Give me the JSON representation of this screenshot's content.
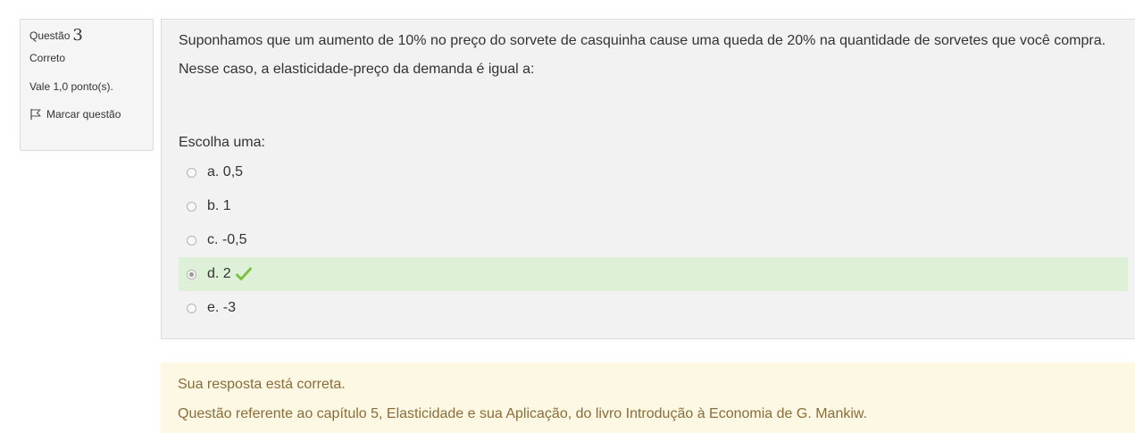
{
  "question_info": {
    "label": "Questão",
    "number": "3",
    "state": "Correto",
    "grade": "Vale 1,0 ponto(s).",
    "flag_label": "Marcar questão"
  },
  "question": {
    "text": "Suponhamos que um aumento de 10% no preço do sorvete de casquinha cause uma queda de 20% na quantidade de sorvetes que você compra.",
    "text2": "Nesse caso, a elasticidade-preço da demanda é igual a:",
    "prompt": "Escolha uma:",
    "options": [
      {
        "label": "a. 0,5"
      },
      {
        "label": "b. 1"
      },
      {
        "label": "c. -0,5"
      },
      {
        "label": "d. 2"
      },
      {
        "label": "e. -3"
      }
    ]
  },
  "feedback": {
    "specific": "Sua resposta está correta.",
    "general": "Questão referente ao capítulo 5, Elasticidade e sua Aplicação, do livro Introdução à Economia de G. Mankiw."
  },
  "colors": {
    "correct_bg": "#dff0d8",
    "check": "#7bc143",
    "feedback_bg": "#fcf8e3",
    "feedback_text": "#8a6d3b"
  }
}
